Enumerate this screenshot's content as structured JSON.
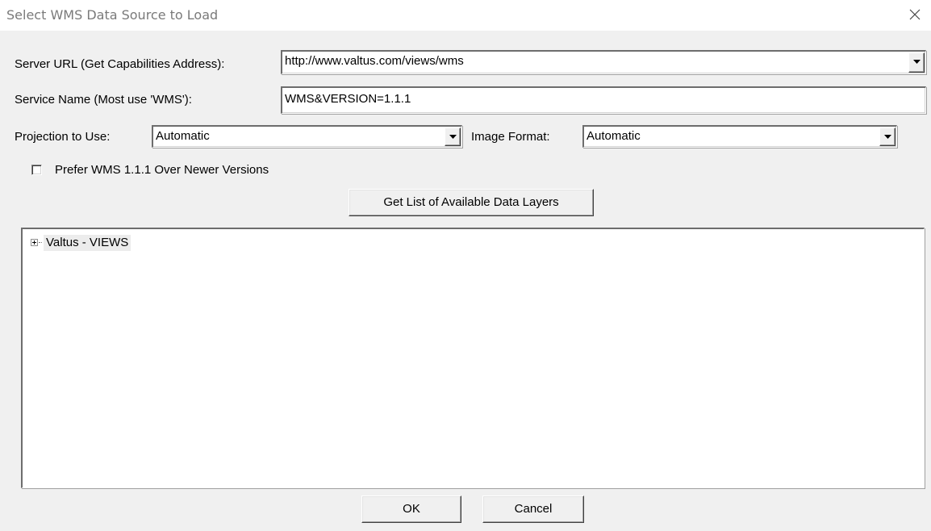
{
  "window": {
    "title": "Select WMS Data Source to Load"
  },
  "form": {
    "server_url_label": "Server URL (Get Capabilities Address):",
    "server_url_value": "http://www.valtus.com/views/wms",
    "service_name_label": "Service Name (Most use 'WMS'):",
    "service_name_value": "WMS&VERSION=1.1.1",
    "projection_label": "Projection to Use:",
    "projection_value": "Automatic",
    "image_format_label": "Image Format:",
    "image_format_value": "Automatic",
    "prefer_wms_label": "Prefer WMS 1.1.1 Over Newer Versions",
    "prefer_wms_checked": false,
    "get_layers_button": "Get List of Available Data Layers"
  },
  "tree": {
    "nodes": [
      {
        "label": "Valtus - VIEWS",
        "expanded": false
      }
    ]
  },
  "buttons": {
    "ok": "OK",
    "cancel": "Cancel"
  },
  "icons": {
    "close": "close-icon",
    "dropdown": "chevron-down-icon",
    "expander": "plus-box-icon"
  }
}
